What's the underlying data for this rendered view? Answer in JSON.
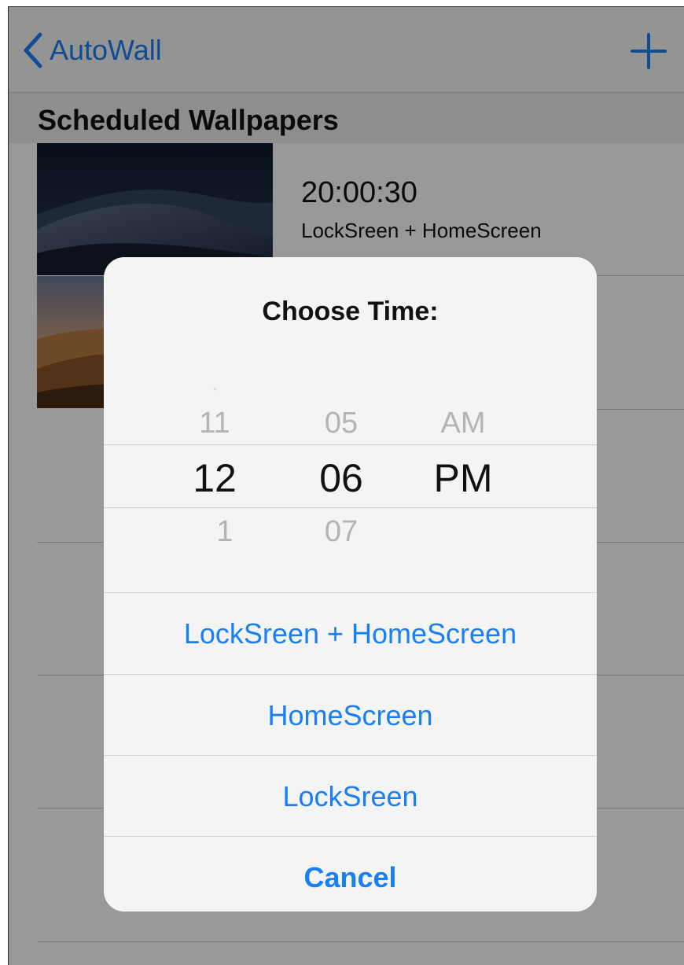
{
  "navbar": {
    "back_label": "AutoWall",
    "back_icon": "chevron-left-icon",
    "add_icon": "plus-icon",
    "accent_color": "#1a7ff4"
  },
  "section": {
    "title": "Scheduled Wallpapers"
  },
  "list": {
    "items": [
      {
        "time": "20:00:30",
        "target": "LockSreen + HomeScreen",
        "thumbnail": "dark-desert-dunes"
      },
      {
        "time": "",
        "target": "",
        "thumbnail": "sunset-desert-dunes"
      }
    ]
  },
  "sheet": {
    "title": "Choose Time:",
    "picker": {
      "hour": {
        "prev": "11",
        "selected": "12",
        "next": "1"
      },
      "minute": {
        "prev": "05",
        "selected": "06",
        "next": "07"
      },
      "period": {
        "prev": "AM",
        "selected": "PM"
      }
    },
    "buttons": [
      {
        "label": "LockSreen + HomeScreen"
      },
      {
        "label": "HomeScreen"
      },
      {
        "label": "LockSreen"
      },
      {
        "label": "Cancel"
      }
    ]
  }
}
